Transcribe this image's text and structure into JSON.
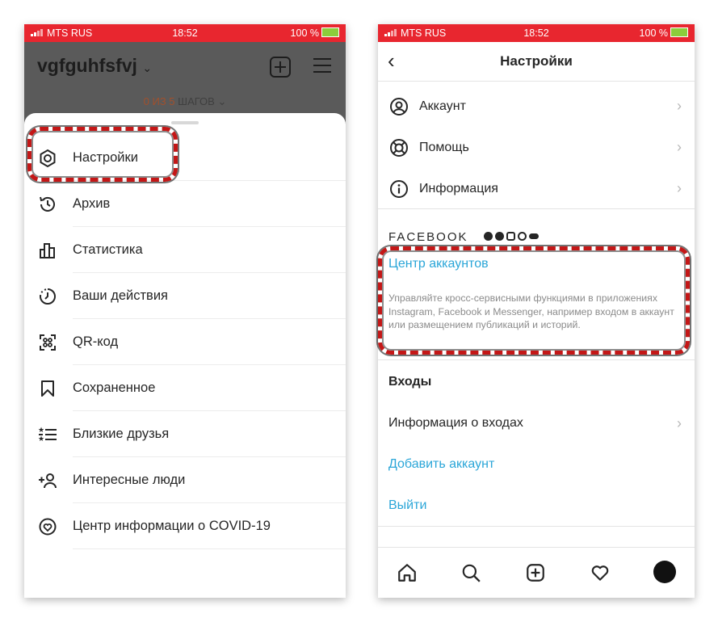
{
  "left": {
    "status": {
      "carrier": "MTS RUS",
      "time": "18:52",
      "battery": "100 %"
    },
    "username": "vgfguhfsfvj",
    "steps": {
      "count": "0 ИЗ 5",
      "label": "ШАГОВ"
    },
    "menu": [
      {
        "label": "Настройки",
        "icon": "settings-icon"
      },
      {
        "label": "Архив",
        "icon": "archive-icon"
      },
      {
        "label": "Статистика",
        "icon": "insights-icon"
      },
      {
        "label": "Ваши действия",
        "icon": "activity-icon"
      },
      {
        "label": "QR-код",
        "icon": "qr-code-icon"
      },
      {
        "label": "Сохраненное",
        "icon": "bookmark-icon"
      },
      {
        "label": "Близкие друзья",
        "icon": "close-friends-icon"
      },
      {
        "label": "Интересные люди",
        "icon": "discover-people-icon"
      },
      {
        "label": "Центр информации о COVID-19",
        "icon": "covid-info-icon"
      }
    ]
  },
  "right": {
    "status": {
      "carrier": "MTS RUS",
      "time": "18:52",
      "battery": "100 %"
    },
    "title": "Настройки",
    "items": [
      {
        "label": "Аккаунт",
        "icon": "account-icon"
      },
      {
        "label": "Помощь",
        "icon": "help-icon"
      },
      {
        "label": "Информация",
        "icon": "info-icon"
      }
    ],
    "facebook": {
      "heading": "FACEBOOK",
      "accounts_center": "Центр аккаунтов",
      "description": "Управляйте кросс-сервисными функциями в приложениях Instagram, Facebook и Messenger, например входом в аккаунт или размещением публикаций и историй."
    },
    "logins": {
      "heading": "Входы",
      "login_info": "Информация о входах",
      "add_account": "Добавить аккаунт",
      "logout": "Выйти"
    },
    "tabbar": [
      "home-icon",
      "search-icon",
      "new-post-icon",
      "activity-heart-icon",
      "profile-avatar"
    ]
  },
  "colors": {
    "status_bar": "#e8262f",
    "link": "#2ba6d8",
    "highlight": "#c41717"
  }
}
